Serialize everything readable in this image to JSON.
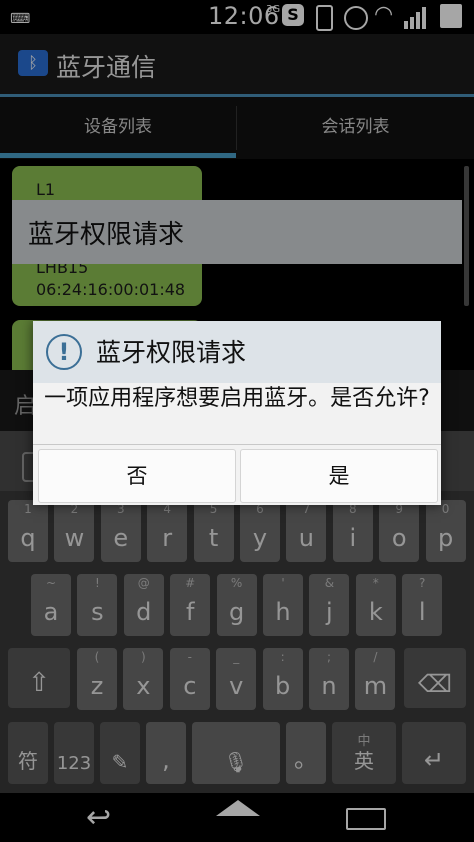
{
  "status_bar": {
    "time": "12:06",
    "network_type": "3G"
  },
  "app": {
    "title": "蓝牙通信"
  },
  "tabs": [
    {
      "label": "设备列表",
      "selected": true
    },
    {
      "label": "会话列表",
      "selected": false
    }
  ],
  "devices": [
    {
      "name": "L1",
      "address": ""
    },
    {
      "name": "LHB15",
      "address": "06:24:16:00:01:48"
    }
  ],
  "permission_banner": {
    "title": "蓝牙权限请求"
  },
  "input": {
    "placeholder_visible": "启"
  },
  "dialog": {
    "title": "蓝牙权限请求",
    "message": "一项应用程序想要启用蓝牙。是否允许?",
    "deny_label": "否",
    "allow_label": "是"
  },
  "keyboard": {
    "row1": [
      {
        "main": "q",
        "hint": "1"
      },
      {
        "main": "w",
        "hint": "2"
      },
      {
        "main": "e",
        "hint": "3"
      },
      {
        "main": "r",
        "hint": "4"
      },
      {
        "main": "t",
        "hint": "5"
      },
      {
        "main": "y",
        "hint": "6"
      },
      {
        "main": "u",
        "hint": "7"
      },
      {
        "main": "i",
        "hint": "8"
      },
      {
        "main": "o",
        "hint": "9"
      },
      {
        "main": "p",
        "hint": "0"
      }
    ],
    "row2": [
      {
        "main": "a",
        "hint": "~"
      },
      {
        "main": "s",
        "hint": "!"
      },
      {
        "main": "d",
        "hint": "@"
      },
      {
        "main": "f",
        "hint": "#"
      },
      {
        "main": "g",
        "hint": "%"
      },
      {
        "main": "h",
        "hint": "'"
      },
      {
        "main": "j",
        "hint": "&"
      },
      {
        "main": "k",
        "hint": "*"
      },
      {
        "main": "l",
        "hint": "?"
      }
    ],
    "row3": [
      {
        "main": "z",
        "hint": "("
      },
      {
        "main": "x",
        "hint": ")"
      },
      {
        "main": "c",
        "hint": "-"
      },
      {
        "main": "v",
        "hint": "_"
      },
      {
        "main": "b",
        "hint": ":"
      },
      {
        "main": "n",
        "hint": ";"
      },
      {
        "main": "m",
        "hint": "/"
      }
    ],
    "symbols_label": "符",
    "numbers_label": "123",
    "comma_label": ",",
    "period_label": "。",
    "lang_label_top": "中",
    "lang_label": "英"
  },
  "colors": {
    "tab_accent": "#4aa0c9",
    "bubble": "#8cbf52",
    "dialog_header": "#dde3e8"
  }
}
